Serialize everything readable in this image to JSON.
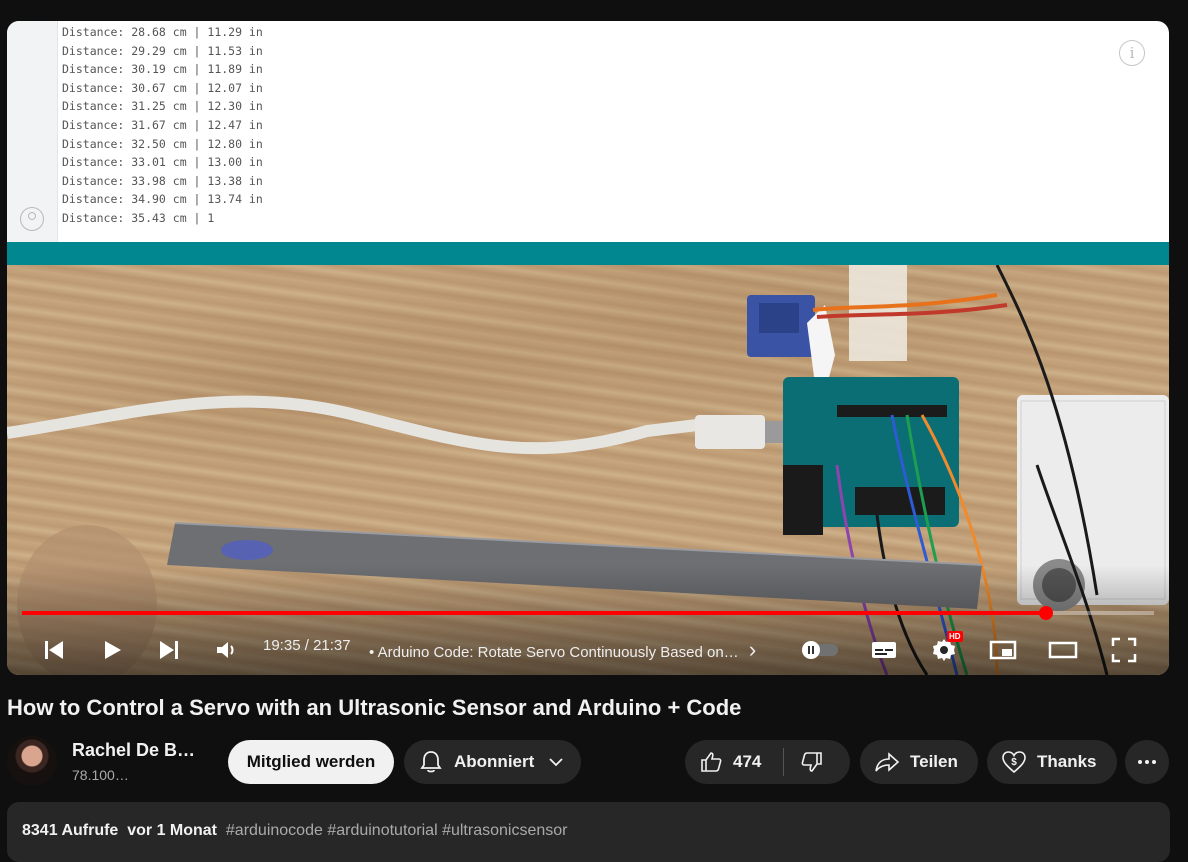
{
  "serial_monitor": {
    "lines": [
      "Distance: 28.68 cm | 11.29 in",
      "Distance: 29.29 cm | 11.53 in",
      "Distance: 30.19 cm | 11.89 in",
      "Distance: 30.67 cm | 12.07 in",
      "Distance: 31.25 cm | 12.30 in",
      "Distance: 31.67 cm | 12.47 in",
      "Distance: 32.50 cm | 12.80 in",
      "Distance: 33.01 cm | 13.00 in",
      "Distance: 33.98 cm | 13.38 in",
      "Distance: 34.90 cm | 13.74 in",
      "Distance: 35.43 cm | 1"
    ],
    "info_icon_glyph": "i"
  },
  "player": {
    "current_time": "19:35",
    "separator": " / ",
    "duration": "21:37",
    "chapter_bullet": "•",
    "chapter_title": "Arduino Code: Rotate Servo Continuously Based on…",
    "chapter_chevron": "›",
    "progress_fraction": 0.905,
    "hd_badge": "HD",
    "accent_color": "#ff0000"
  },
  "video": {
    "title": "How to Control a Servo with an Ultrasonic Sensor and Arduino + Code"
  },
  "channel": {
    "name": "Rachel De B…",
    "subscribers": "78.100…"
  },
  "actions": {
    "join_label": "Mitglied werden",
    "subscribed_label": "Abonniert",
    "like_count": "474",
    "share_label": "Teilen",
    "thanks_label": "Thanks"
  },
  "description": {
    "views": "8341 Aufrufe",
    "age": "vor 1 Monat",
    "hashtags": "#arduinocode #arduinotutorial #ultrasonicsensor"
  }
}
